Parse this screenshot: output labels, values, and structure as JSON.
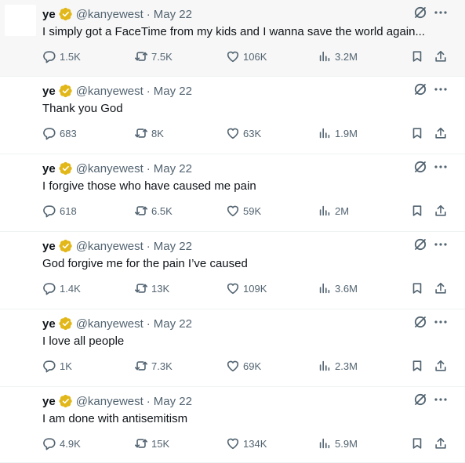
{
  "colors": {
    "text_primary": "#0f1419",
    "text_secondary": "#536471",
    "verified_gold": "#e2b719",
    "highlight_bg": "#f7f7f7",
    "divider": "#eff3f4"
  },
  "icons": {
    "verified": "gold-verified-badge-icon",
    "grok": "grok-icon",
    "more": "more-icon",
    "reply": "reply-icon",
    "retweet": "retweet-icon",
    "like": "heart-icon",
    "views": "views-icon",
    "bookmark": "bookmark-icon",
    "share": "share-icon"
  },
  "tweets": [
    {
      "author": "ye",
      "handle": "@kanyewest",
      "separator": "·",
      "date": "May 22",
      "text": "I simply got a FaceTime from my kids and I wanna save the world again...",
      "replies": "1.5K",
      "retweets": "7.5K",
      "likes": "106K",
      "views": "3.2M"
    },
    {
      "author": "ye",
      "handle": "@kanyewest",
      "separator": "·",
      "date": "May 22",
      "text": "Thank you God",
      "replies": "683",
      "retweets": "8K",
      "likes": "63K",
      "views": "1.9M"
    },
    {
      "author": "ye",
      "handle": "@kanyewest",
      "separator": "·",
      "date": "May 22",
      "text": "I forgive those who have caused me pain",
      "replies": "618",
      "retweets": "6.5K",
      "likes": "59K",
      "views": "2M"
    },
    {
      "author": "ye",
      "handle": "@kanyewest",
      "separator": "·",
      "date": "May 22",
      "text": "God forgive me for the pain I’ve caused",
      "replies": "1.4K",
      "retweets": "13K",
      "likes": "109K",
      "views": "3.6M"
    },
    {
      "author": "ye",
      "handle": "@kanyewest",
      "separator": "·",
      "date": "May 22",
      "text": "I love all people",
      "replies": "1K",
      "retweets": "7.3K",
      "likes": "69K",
      "views": "2.3M"
    },
    {
      "author": "ye",
      "handle": "@kanyewest",
      "separator": "·",
      "date": "May 22",
      "text": "I am done with antisemitism",
      "replies": "4.9K",
      "retweets": "15K",
      "likes": "134K",
      "views": "5.9M"
    }
  ]
}
